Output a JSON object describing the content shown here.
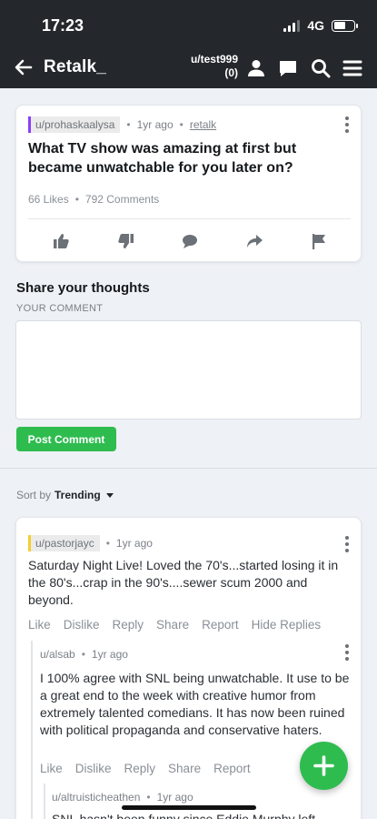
{
  "status": {
    "time": "17:23",
    "network": "4G",
    "battery_level": 0.6
  },
  "header": {
    "title": "Retalk_",
    "username": "u/test999",
    "count": "(0)"
  },
  "post": {
    "author": "u/prohaskaalysa",
    "age": "1yr ago",
    "community": "retalk",
    "title": "What TV show was amazing at first but became unwatchable for you later on?",
    "likes": "66 Likes",
    "comments": "792 Comments"
  },
  "comment_form": {
    "heading": "Share your thoughts",
    "label": "YOUR COMMENT",
    "value": "",
    "placeholder": "",
    "submit_label": "Post Comment"
  },
  "sort": {
    "prefix": "Sort by",
    "value": "Trending"
  },
  "comments": [
    {
      "author": "u/pastorjayc",
      "age": "1yr ago",
      "text": "Saturday Night Live! Loved the 70's...started losing it in the 80's...crap in the 90's....sewer scum 2000 and beyond.",
      "actions": [
        "Like",
        "Dislike",
        "Reply",
        "Share",
        "Report",
        "Hide Replies"
      ],
      "replies": [
        {
          "author": "u/alsab",
          "age": "1yr ago",
          "text": "I 100% agree with SNL being unwatchable. It use to be a great end to the week with creative humor from extremely talented comedians. It has now been ruined with political propaganda and conservative haters.",
          "actions": [
            "Like",
            "Dislike",
            "Reply",
            "Share",
            "Report"
          ],
          "replies": [
            {
              "author": "u/altruisticheathen",
              "age": "1yr ago",
              "text": "SNL hasn't been funny since Eddie Murphy left"
            }
          ]
        }
      ]
    }
  ],
  "colors": {
    "header_bg": "#24272b",
    "accent_green": "#2ebc4f",
    "page_bg": "#eef1f5"
  }
}
